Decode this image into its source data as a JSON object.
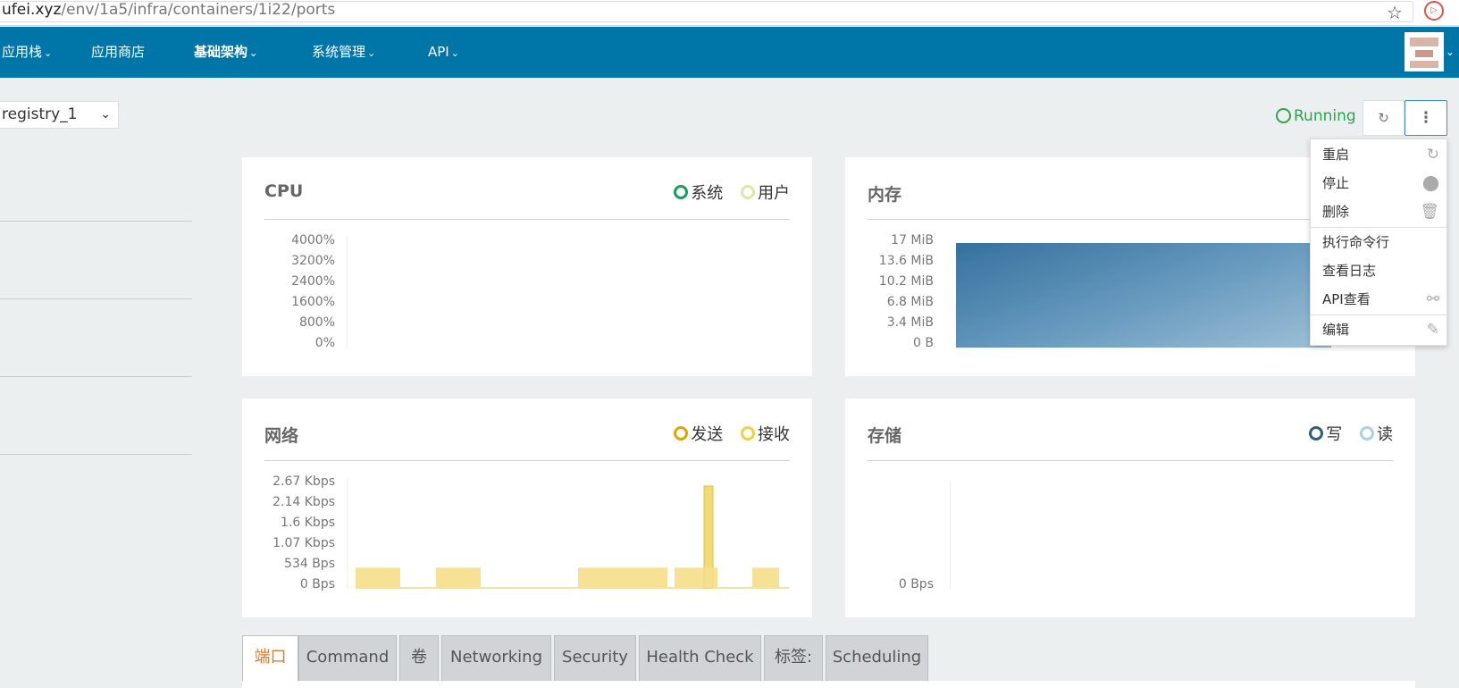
{
  "browser": {
    "url_host": "ufei.xyz",
    "url_path": "/env/1a5/infra/containers/1i22/ports",
    "star_icon": "star-icon",
    "extension_icon": "extension-icon"
  },
  "nav": {
    "items": [
      {
        "label": "应用栈",
        "chevron": "⌄"
      },
      {
        "label": "应用商店"
      },
      {
        "label": "基础架构",
        "chevron": "⌄"
      },
      {
        "label": "系统管理",
        "chevron": "⌄"
      },
      {
        "label": "API",
        "chevron": "⌄"
      }
    ],
    "avatar_chevron": "⌄",
    "color": "#0075a8"
  },
  "container_select": {
    "value": "registry_1",
    "chevron": "⌄"
  },
  "status": {
    "label": "Running",
    "color": "#2ea44f"
  },
  "actions": {
    "restart_icon": "restart-icon",
    "more_glyph": "⋮"
  },
  "menu": {
    "items": [
      {
        "label": "重启",
        "icon": "restart-icon",
        "glyph": "↻"
      },
      {
        "label": "停止",
        "icon": "stop-icon",
        "glyph": "⬤"
      },
      {
        "label": "删除",
        "icon": "trash-icon",
        "glyph": "🗑"
      },
      {
        "label": "执行命令行"
      },
      {
        "label": "查看日志"
      },
      {
        "label": "API查看",
        "icon": "api-icon",
        "glyph": "⚯"
      },
      {
        "label": "编辑",
        "icon": "pencil-icon",
        "glyph": "✎"
      }
    ]
  },
  "panels": {
    "cpu": {
      "title": "CPU",
      "legend": [
        {
          "label": "系统",
          "color": "#1a9c5a"
        },
        {
          "label": "用户",
          "color": "#d9e7a8"
        }
      ],
      "yticks": [
        "4000%",
        "3200%",
        "2400%",
        "1600%",
        "800%",
        "0%"
      ]
    },
    "memory": {
      "title": "内存",
      "yticks": [
        "17 MiB",
        "13.6 MiB",
        "10.2 MiB",
        "6.8 MiB",
        "3.4 MiB",
        "0 B"
      ],
      "fill_color": "#3b7aa8"
    },
    "network": {
      "title": "网络",
      "legend": [
        {
          "label": "发送",
          "color": "#e0a500"
        },
        {
          "label": "接收",
          "color": "#f0d040"
        }
      ],
      "yticks": [
        "2.67 Kbps",
        "2.14 Kbps",
        "1.6 Kbps",
        "1.07 Kbps",
        "534 Bps",
        "0 Bps"
      ]
    },
    "storage": {
      "title": "存储",
      "legend": [
        {
          "label": "写",
          "color": "#2d5f7a"
        },
        {
          "label": "读",
          "color": "#a8d4e0"
        }
      ],
      "yticks": [
        "0 Bps"
      ]
    }
  },
  "chart_data": {
    "type": "bar",
    "title": "网络",
    "ylabel": "",
    "ylim": [
      0,
      2.67
    ],
    "yunit": "Kbps",
    "series": [
      {
        "name": "发送",
        "values": [
          0.53,
          0.53,
          0.0,
          0.53,
          0.53,
          2.67,
          0.53
        ]
      },
      {
        "name": "接收",
        "values": [
          0.53,
          0.53,
          0.0,
          0.53,
          0.53,
          0.0,
          0.53
        ]
      }
    ],
    "categories": [
      "",
      "",
      "",
      "",
      "",
      "",
      ""
    ]
  },
  "tabs": [
    {
      "label": "端口",
      "active": true
    },
    {
      "label": "Command"
    },
    {
      "label": "卷"
    },
    {
      "label": "Networking"
    },
    {
      "label": "Security"
    },
    {
      "label": "Health Check"
    },
    {
      "label": "标签:"
    },
    {
      "label": "Scheduling"
    }
  ]
}
